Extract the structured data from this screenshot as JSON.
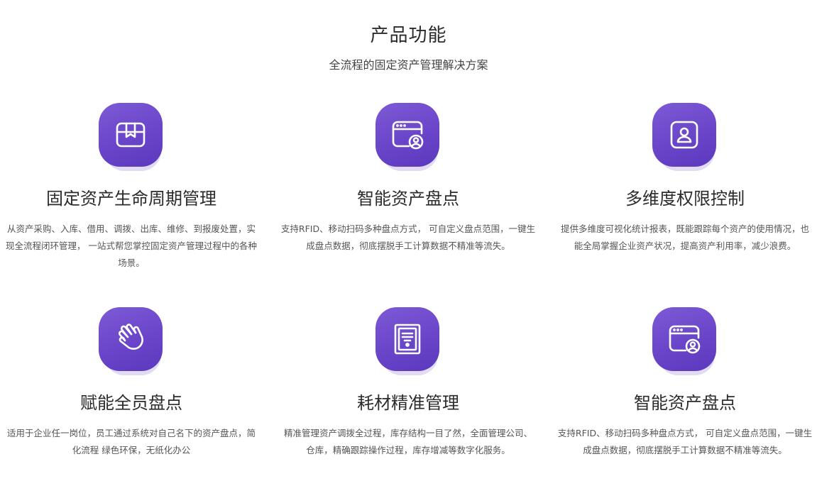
{
  "header": {
    "title": "产品功能",
    "subtitle": "全流程的固定资产管理解决方案"
  },
  "features": [
    {
      "icon": "box-icon",
      "title": "固定资产生命周期管理",
      "desc": "从资产采购、入库、借用、调拨、出库、维修、到报废处置，实现全流程闭环管理， 一站式帮您掌控固定资产管理过程中的各种场景。"
    },
    {
      "icon": "window-user-icon",
      "title": "智能资产盘点",
      "desc": "支持RFID、移动扫码多种盘点方式， 可自定义盘点范围，一键生成盘点数据，彻底摆脱手工计算数据不精准等流失。"
    },
    {
      "icon": "user-card-icon",
      "title": "多维度权限控制",
      "desc": "提供多维度可视化统计报表，既能跟踪每个资产的使用情况，也能全局掌握企业资产状况，提高资产利用率，减少浪费。"
    },
    {
      "icon": "hand-wave-icon",
      "title": "赋能全员盘点",
      "desc": "适用于企业任一岗位，员工通过系统对自己名下的资产盘点，简化流程 绿色环保，无纸化办公"
    },
    {
      "icon": "document-icon",
      "title": "耗材精准管理",
      "desc": "精准管理资产调拨全过程，库存结构一目了然，全面管理公司、仓库，精确跟踪操作过程，库存增减等数字化服务。"
    },
    {
      "icon": "window-user-icon",
      "title": "智能资产盘点",
      "desc": "支持RFID、移动扫码多种盘点方式， 可自定义盘点范围，一键生成盘点数据，彻底摆脱手工计算数据不精准等流失。"
    }
  ],
  "colors": {
    "icon_bg": "#6a45c9",
    "icon_shadow": "#d9d2f0"
  }
}
